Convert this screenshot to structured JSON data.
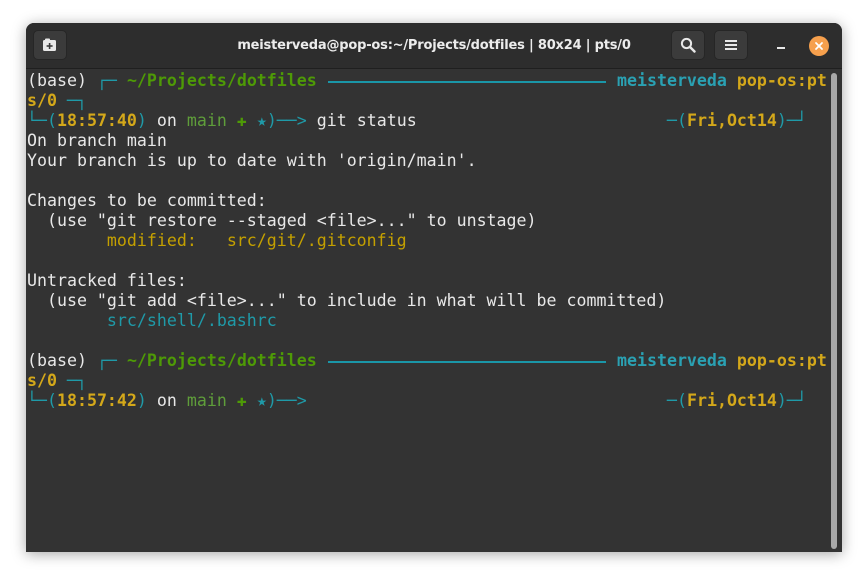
{
  "window": {
    "title": "meisterveda@pop-os:~/Projects/dotfiles | 80x24 | pts/0",
    "icons": {
      "new_tab": "new-tab-icon",
      "search": "search-icon",
      "menu": "hamburger-menu-icon",
      "minimize": "minimize-icon",
      "close": "close-icon"
    },
    "colors": {
      "close": "#f6a04d",
      "background": "#333333"
    }
  },
  "prompt1": {
    "env": "(base)",
    "corner_top": "┌─",
    "path": "~/Projects/dotfiles",
    "user": "meisterveda",
    "host_part1": "pop-os:pt",
    "host_part2": "s/0",
    "tail": "─┐",
    "corner_bottom": "└─(",
    "time": "18:57:40",
    "close_paren": ")",
    "on": " on ",
    "branch": "main",
    "plus": " ✚",
    "star": " ★",
    "arrow": ")──>",
    "command": " git status",
    "date_prefix": "─(",
    "date": "Fri,Oct14",
    "date_suffix": ")─┘"
  },
  "output": {
    "line1": "On branch main",
    "line2": "Your branch is up to date with 'origin/main'.",
    "line3": "Changes to be committed:",
    "line4": "  (use \"git restore --staged <file>...\" to unstage)",
    "line5_label": "        modified:   ",
    "line5_file": "src/git/.gitconfig",
    "line6": "Untracked files:",
    "line7": "  (use \"git add <file>...\" to include in what will be committed)",
    "line8": "        src/shell/.bashrc"
  },
  "prompt2": {
    "env": "(base)",
    "corner_top": "┌─",
    "path": "~/Projects/dotfiles",
    "user": "meisterveda",
    "host_part1": "pop-os:pt",
    "host_part2": "s/0",
    "tail": "─┐",
    "corner_bottom": "└─(",
    "time": "18:57:42",
    "close_paren": ")",
    "on": " on ",
    "branch": "main",
    "plus": " ✚",
    "star": " ★",
    "arrow": ")──>",
    "date_prefix": "─(",
    "date": "Fri,Oct14",
    "date_suffix": ")─┘"
  }
}
